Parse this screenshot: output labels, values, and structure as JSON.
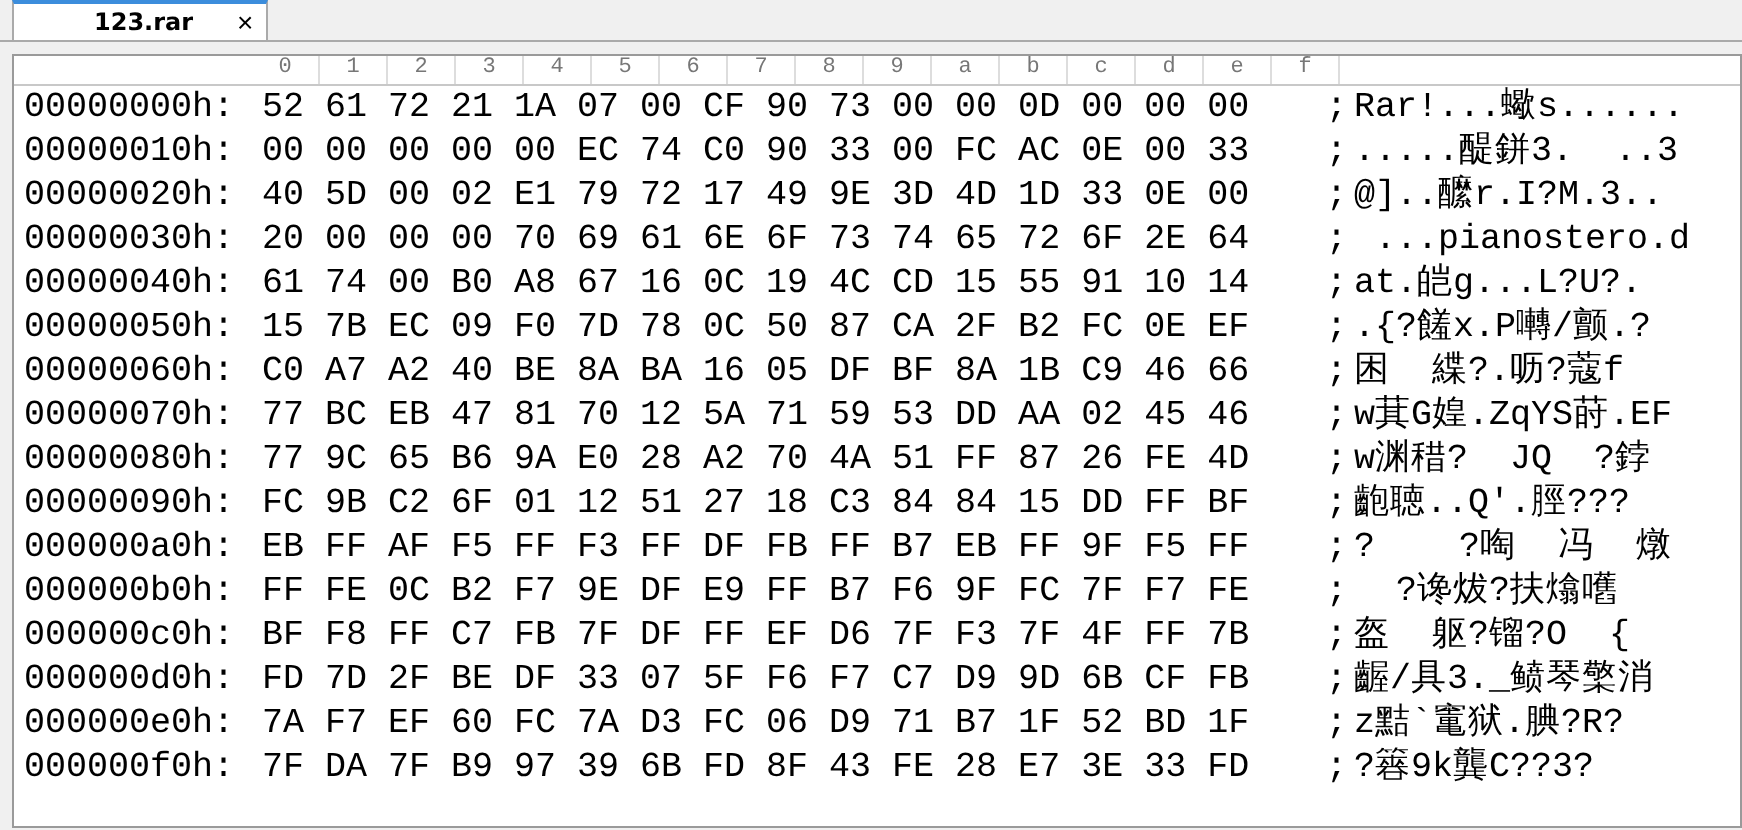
{
  "tab": {
    "title": "123.rar",
    "close": "×",
    "selected": true
  },
  "ruler": [
    "0",
    "1",
    "2",
    "3",
    "4",
    "5",
    "6",
    "7",
    "8",
    "9",
    "a",
    "b",
    "c",
    "d",
    "e",
    "f"
  ],
  "rows": [
    {
      "offset": "00000000h:",
      "hex": "52 61 72 21 1A 07 00 CF 90 73 00 00 0D 00 00 00",
      "sep": ";",
      "text": "Rar!...蠍s......"
    },
    {
      "offset": "00000010h:",
      "hex": "00 00 00 00 00 EC 74 C0 90 33 00 FC AC 0E 00 33",
      "sep": ";",
      "text": ".....醍鉼3.  ..3"
    },
    {
      "offset": "00000020h:",
      "hex": "40 5D 00 02 E1 79 72 17 49 9E 3D 4D 1D 33 0E 00",
      "sep": ";",
      "text": "@]..醿r.I?M.3.."
    },
    {
      "offset": "00000030h:",
      "hex": "20 00 00 00 70 69 61 6E 6F 73 74 65 72 6F 2E 64",
      "sep": ";",
      "text": " ...pianostero.d"
    },
    {
      "offset": "00000040h:",
      "hex": "61 74 00 B0 A8 67 16 0C 19 4C CD 15 55 91 10 14",
      "sep": ";",
      "text": "at.皑g...L?U?."
    },
    {
      "offset": "00000050h:",
      "hex": "15 7B EC 09 F0 7D 78 0C 50 87 CA 2F B2 FC 0E EF",
      "sep": ";",
      "text": ".{?饈x.P囀/颤.?"
    },
    {
      "offset": "00000060h:",
      "hex": "C0 A7 A2 40 BE 8A BA 16 05 DF BF 8A 1B C9 46 66",
      "sep": ";",
      "text": "困  緤?.呖?蔻f"
    },
    {
      "offset": "00000070h:",
      "hex": "77 BC EB 47 81 70 12 5A 71 59 53 DD AA 02 45 46",
      "sep": ";",
      "text": "w萁G媓.ZqYS莳.EF"
    },
    {
      "offset": "00000080h:",
      "hex": "77 9C 65 B6 9A E0 28 A2 70 4A 51 FF 87 26 FE 4D",
      "sep": ";",
      "text": "w渊稓?  JQ  ?鋍"
    },
    {
      "offset": "00000090h:",
      "hex": "FC 9B C2 6F 01 12 51 27 18 C3 84 84 15 DD FF BF",
      "sep": ";",
      "text": "齙聴..Q'.脛???"
    },
    {
      "offset": "000000a0h:",
      "hex": "EB FF AF F5 FF F3 FF DF FB FF B7 EB FF 9F F5 FF",
      "sep": ";",
      "text": "?    ?啕  冯  燉"
    },
    {
      "offset": "000000b0h:",
      "hex": "FF FE 0C B2 F7 9E DF E9 FF B7 F6 9F FC 7F F7 FE",
      "sep": ";",
      "text": "  ?谗炦?扶熻嚿"
    },
    {
      "offset": "000000c0h:",
      "hex": "BF F8 FF C7 FB 7F DF FF EF D6 7F F3 7F 4F FF 7B",
      "sep": ";",
      "text": "盔  躯?镏?O  {"
    },
    {
      "offset": "000000d0h:",
      "hex": "FD 7D 2F BE DF 33 07 5F F6 F7 C7 D9 9D 6B CF FB",
      "sep": ";",
      "text": "齷/具3._鲼琴檠消"
    },
    {
      "offset": "000000e0h:",
      "hex": "7A F7 EF 60 FC 7A D3 FC 06 D9 71 B7 1F 52 BD 1F",
      "sep": ";",
      "text": "z黠`竃狱.腆?R?"
    },
    {
      "offset": "000000f0h:",
      "hex": "7F DA 7F B9 97 39 6B FD 8F 43 FE 28 E7 3E 33 FD",
      "sep": ";",
      "text": "?簭9k龔C??3?"
    }
  ]
}
